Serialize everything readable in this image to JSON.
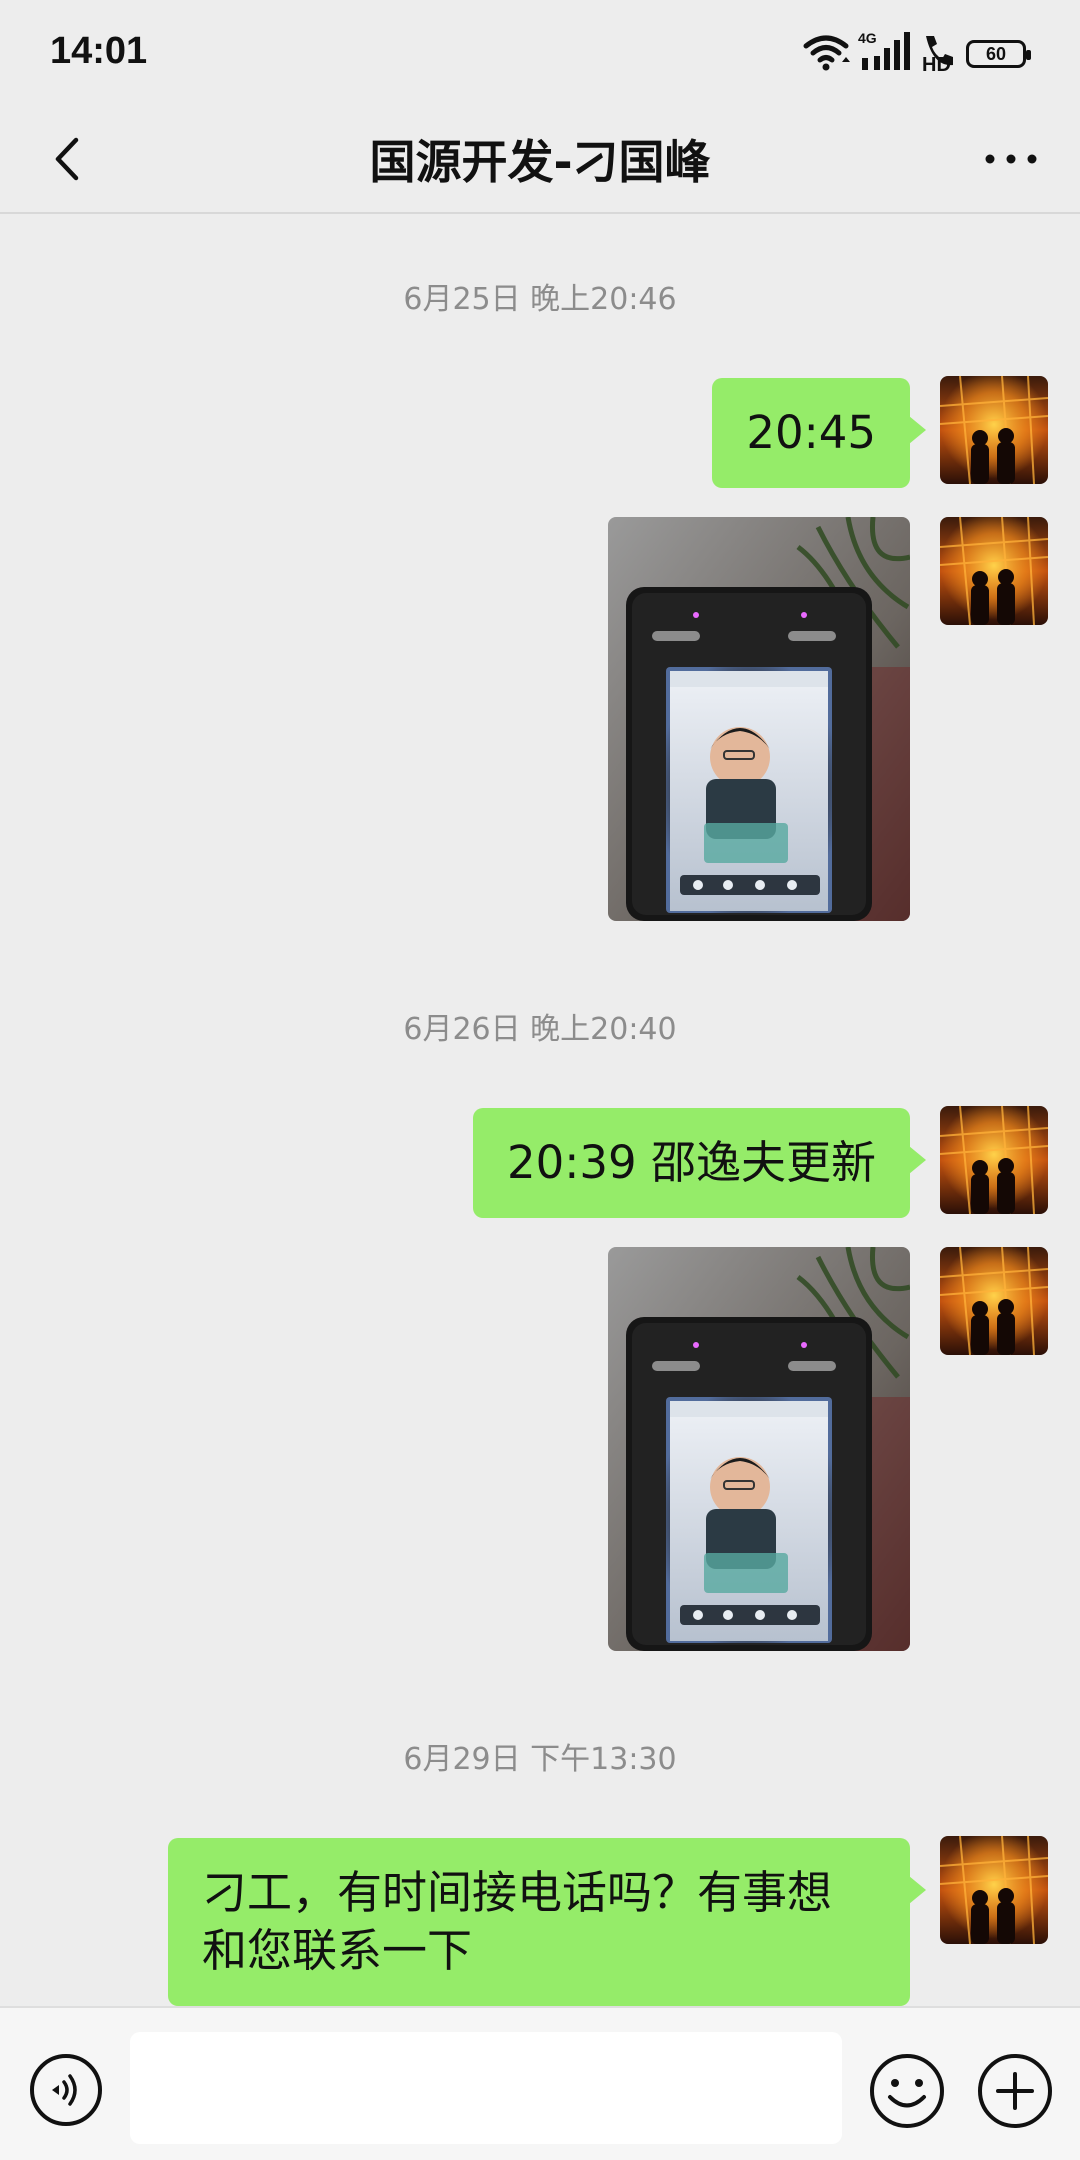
{
  "status_bar": {
    "time": "14:01",
    "network": "4G",
    "hd": "HD",
    "battery": "60"
  },
  "header": {
    "title": "国源开发-刁国峰",
    "back_icon": "chevron-left-icon",
    "more_icon": "more-dots-icon"
  },
  "messages": [
    {
      "type": "timestamp",
      "text": "6月25日 晚上20:46"
    },
    {
      "type": "text",
      "sender": "self",
      "text": "20:45"
    },
    {
      "type": "image",
      "sender": "self",
      "description": "face-recognition-device-photo"
    },
    {
      "type": "timestamp",
      "text": "6月26日 晚上20:40"
    },
    {
      "type": "text",
      "sender": "self",
      "text": "20:39 邵逸夫更新"
    },
    {
      "type": "image",
      "sender": "self",
      "description": "face-recognition-device-photo"
    },
    {
      "type": "timestamp",
      "text": "6月29日 下午13:30"
    },
    {
      "type": "text",
      "sender": "self",
      "text": "刁工，有时间接电话吗？有事想和您联系一下"
    }
  ],
  "input_bar": {
    "placeholder": "",
    "voice_icon": "voice-icon",
    "emoji_icon": "emoji-icon",
    "plus_icon": "plus-icon"
  },
  "colors": {
    "bubble": "#95ec69",
    "background": "#ededed",
    "timestamp": "#8c8c8c"
  }
}
